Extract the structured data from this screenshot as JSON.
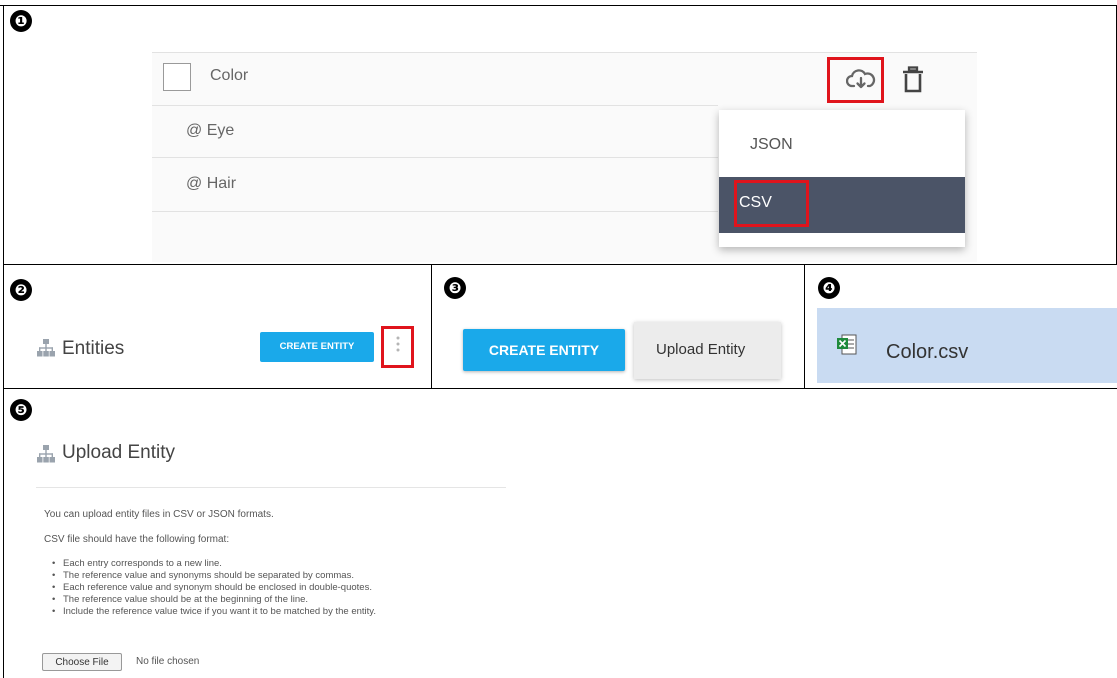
{
  "panel_numbers": [
    "❶",
    "❷",
    "❸",
    "❹",
    "❺"
  ],
  "panel1": {
    "row_title": "Color",
    "synonyms": [
      "@ Eye",
      "@ Hair"
    ],
    "download_icon": "cloud-download-icon",
    "delete_icon": "trash-icon",
    "menu": {
      "json_label": "JSON",
      "csv_label": "CSV"
    }
  },
  "panel2": {
    "title": "Entities",
    "entity_icon": "hierarchy-icon",
    "create_label": "CREATE ENTITY",
    "more_icon": "vertical-dots-icon"
  },
  "panel3": {
    "create_label": "CREATE ENTITY",
    "upload_label": "Upload Entity"
  },
  "panel4": {
    "file_name": "Color.csv",
    "file_icon": "excel-file-icon"
  },
  "panel5": {
    "title": "Upload Entity",
    "intro": "You can upload entity files in CSV or JSON formats.",
    "format_intro": "CSV file should have the following format:",
    "bullets": [
      "Each entry corresponds to a new line.",
      "The reference value and synonyms should be separated by commas.",
      "Each reference value and synonym should be enclosed in double-quotes.",
      "The reference value should be at the beginning of the line.",
      "Include the reference value twice if you want it to be matched by the entity."
    ],
    "choose_file_label": "Choose File",
    "no_file_text": "No file chosen"
  },
  "colors": {
    "accent_blue": "#1aa9ea",
    "highlight_red": "#e0141c",
    "menu_dark": "#4b5467",
    "file_row_bg": "#c9dbf2"
  }
}
